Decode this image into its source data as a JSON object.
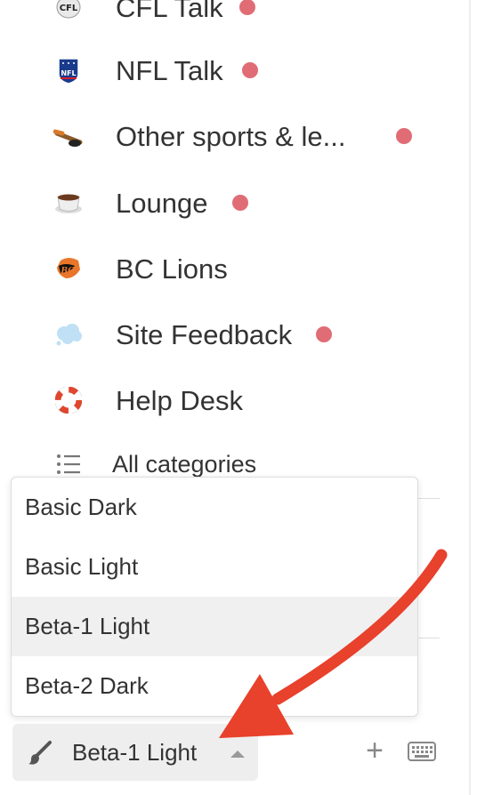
{
  "categories": [
    {
      "name": "CFL Talk",
      "icon": "cfl-logo-icon",
      "unread": true
    },
    {
      "name": "NFL Talk",
      "icon": "nfl-logo-icon",
      "unread": true
    },
    {
      "name": "Other sports & le...",
      "icon": "hockey-stick-icon",
      "unread": true
    },
    {
      "name": "Lounge",
      "icon": "coffee-cup-icon",
      "unread": true
    },
    {
      "name": "BC Lions",
      "icon": "bc-lions-logo-icon",
      "unread": false
    },
    {
      "name": "Site Feedback",
      "icon": "speech-cloud-icon",
      "unread": true
    },
    {
      "name": "Help Desk",
      "icon": "life-ring-icon",
      "unread": false
    }
  ],
  "all_categories": {
    "label": "All categories",
    "icon": "list-icon"
  },
  "theme_menu": {
    "options": [
      "Basic Dark",
      "Basic Light",
      "Beta-1 Light",
      "Beta-2 Dark"
    ],
    "selected": "Beta-1 Light"
  },
  "bottom_bar": {
    "theme_label": "Beta-1 Light",
    "brush_icon": "paintbrush-icon",
    "caret_icon": "caret-up-icon",
    "add_icon": "plus-icon",
    "add_symbol": "+",
    "keyboard_icon": "keyboard-icon"
  },
  "colors": {
    "unread_dot": "#e06c75",
    "arrow": "#e8412c",
    "active_option_bg": "#f0f0f0"
  }
}
